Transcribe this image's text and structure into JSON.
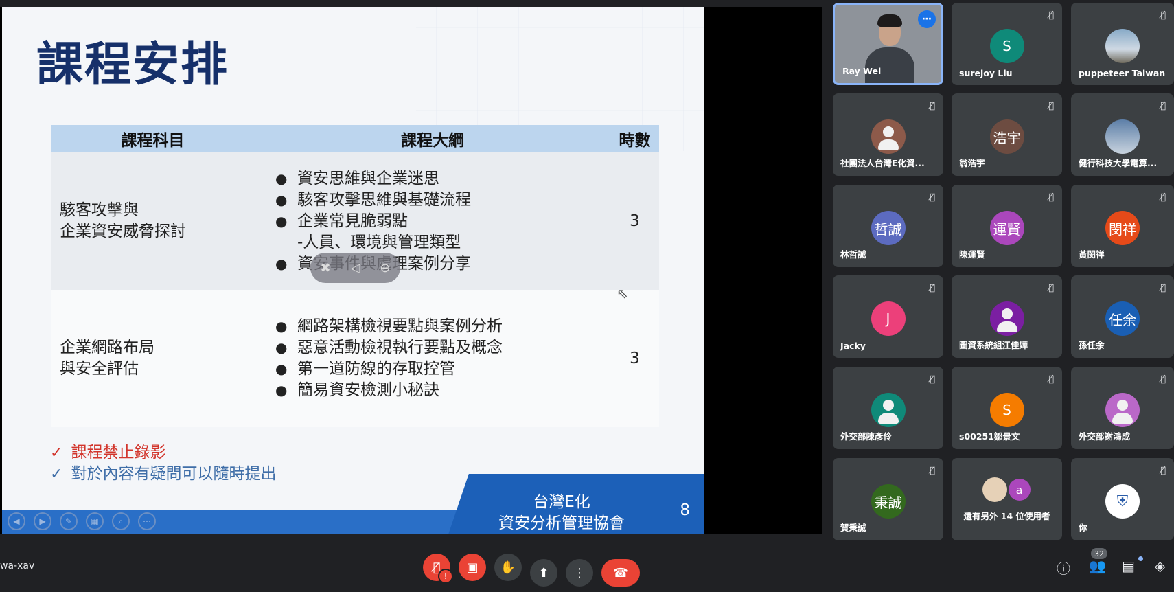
{
  "slide": {
    "title": "課程安排",
    "table": {
      "headers": [
        "課程科目",
        "課程大綱",
        "時數"
      ],
      "rows": [
        {
          "subject_line1": "駭客攻擊與",
          "subject_line2": "企業資安威脅探討",
          "outline": [
            "資安思維與企業迷思",
            "駭客攻擊思維與基礎流程",
            "企業常見脆弱點",
            "-人員、環境與管理類型",
            "資安事件與處理案例分享"
          ],
          "hours": "3"
        },
        {
          "subject_line1": "企業網路布局",
          "subject_line2": "與安全評估",
          "outline": [
            "網路架構檢視要點與案例分析",
            "惡意活動檢視執行要點及概念",
            "第一道防線的存取控管",
            "簡易資安檢測小秘訣"
          ],
          "hours": "3"
        }
      ]
    },
    "notes": [
      "課程禁止錄影",
      "對於內容有疑問可以隨時提出"
    ],
    "org_line1": "台灣E化",
    "org_line2": "資安分析管理協會",
    "page_number": "8"
  },
  "participants": [
    {
      "name": "Ray Wei"
    },
    {
      "name": "surejoy Liu",
      "initial": "S",
      "color": "#0f8a79"
    },
    {
      "name": "puppeteer Taiwan"
    },
    {
      "name": "社團法人台灣E化資..."
    },
    {
      "name": "翁浩宇",
      "initial": "浩宇",
      "color": "#6d4c41"
    },
    {
      "name": "健行科技大學電算..."
    },
    {
      "name": "林哲誠",
      "initial": "哲誠",
      "color": "#5c6bc0"
    },
    {
      "name": "陳運賢",
      "initial": "運賢",
      "color": "#ab47bc"
    },
    {
      "name": "黃閔祥",
      "initial": "閔祥",
      "color": "#e64a19"
    },
    {
      "name": "Jacky",
      "initial": "J",
      "color": "#ec407a"
    },
    {
      "name": "圖資系統組江佳嬅"
    },
    {
      "name": "孫任余",
      "initial": "任余",
      "color": "#1a5fb4"
    },
    {
      "name": "外交部陳彥伶"
    },
    {
      "name": "s00251鄒景文",
      "initial": "S",
      "color": "#f57c00"
    },
    {
      "name": "外交部謝鴻成"
    },
    {
      "name": "賀秉誠",
      "initial": "秉誠",
      "color": "#33691e"
    },
    {
      "name": "還有另外 14 位使用者",
      "extra_initial": "a"
    },
    {
      "name": "你"
    }
  ],
  "bottom": {
    "meeting_code": "wa-xav",
    "participant_count": "32"
  },
  "icons": [
    "mic-off-icon",
    "camera-off-icon",
    "raise-hand-icon",
    "present-icon",
    "more-options-icon",
    "end-call-icon",
    "info-icon",
    "people-icon",
    "chat-icon",
    "activities-icon"
  ]
}
